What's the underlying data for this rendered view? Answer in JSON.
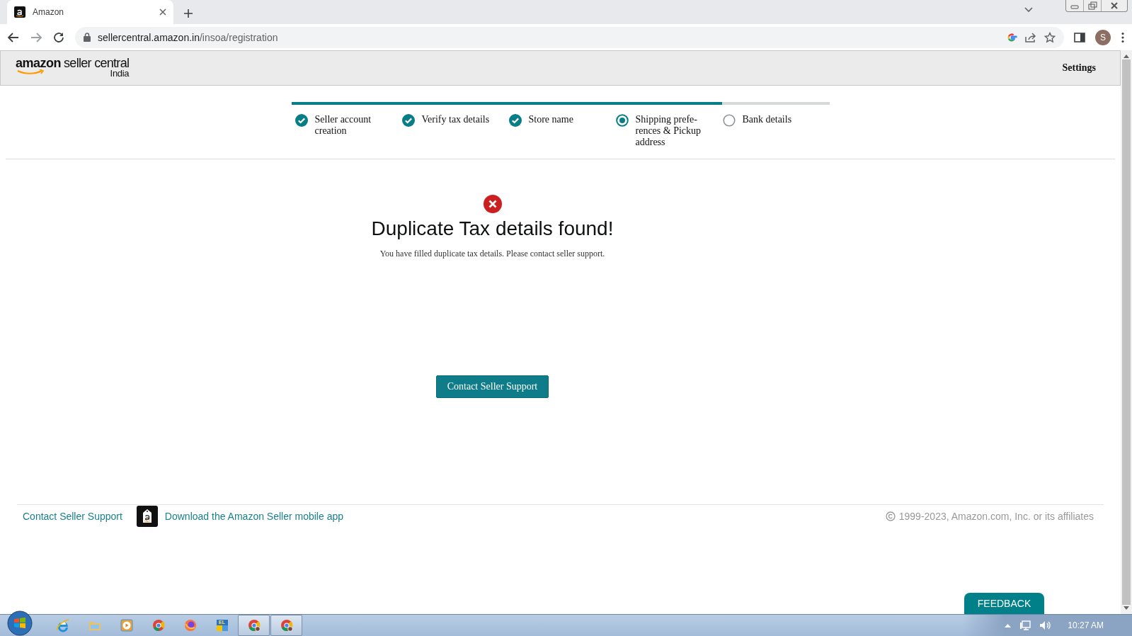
{
  "browser": {
    "tab": {
      "title": "Amazon"
    },
    "address": {
      "host": "sellercentral.amazon.in",
      "path": "/insoa/registration"
    },
    "profile": {
      "initial": "S"
    }
  },
  "header": {
    "logo": {
      "brand": "amazon",
      "product": "seller central",
      "region": "India"
    },
    "settings": "Settings"
  },
  "progress": {
    "level": 0.8,
    "steps": [
      {
        "label": "Seller account creation",
        "done": true
      },
      {
        "label": "Verify tax details",
        "done": true
      },
      {
        "label": "Store name",
        "done": true
      },
      {
        "label": "Shipping prefe-rences & Pickup address",
        "current": true
      },
      {
        "label": "Bank details",
        "done": false,
        "current": false
      }
    ]
  },
  "error": {
    "title": "Duplicate Tax details found!",
    "message": "You have filled duplicate tax details. Please contact seller support.",
    "button": "Contact Seller Support"
  },
  "footer": {
    "links": [
      {
        "kind": "link",
        "label": "Contact Seller Support"
      },
      {
        "kind": "app",
        "label": "Download the Amazon Seller mobile app"
      }
    ],
    "copyright": "1999-2023, Amazon.com, Inc. or its affiliates"
  },
  "feedback": "FEEDBACK",
  "taskbar": {
    "apps": [
      {
        "kind": "ie",
        "open": false
      },
      {
        "kind": "folder",
        "open": false
      },
      {
        "kind": "media",
        "open": false
      },
      {
        "kind": "chrome",
        "open": false
      },
      {
        "kind": "firefox",
        "open": false
      },
      {
        "kind": "tile",
        "label": "EL",
        "open": false
      },
      {
        "kind": "chrome",
        "open": true
      },
      {
        "kind": "chrome",
        "open": true
      }
    ],
    "clock": "10:27 AM"
  }
}
